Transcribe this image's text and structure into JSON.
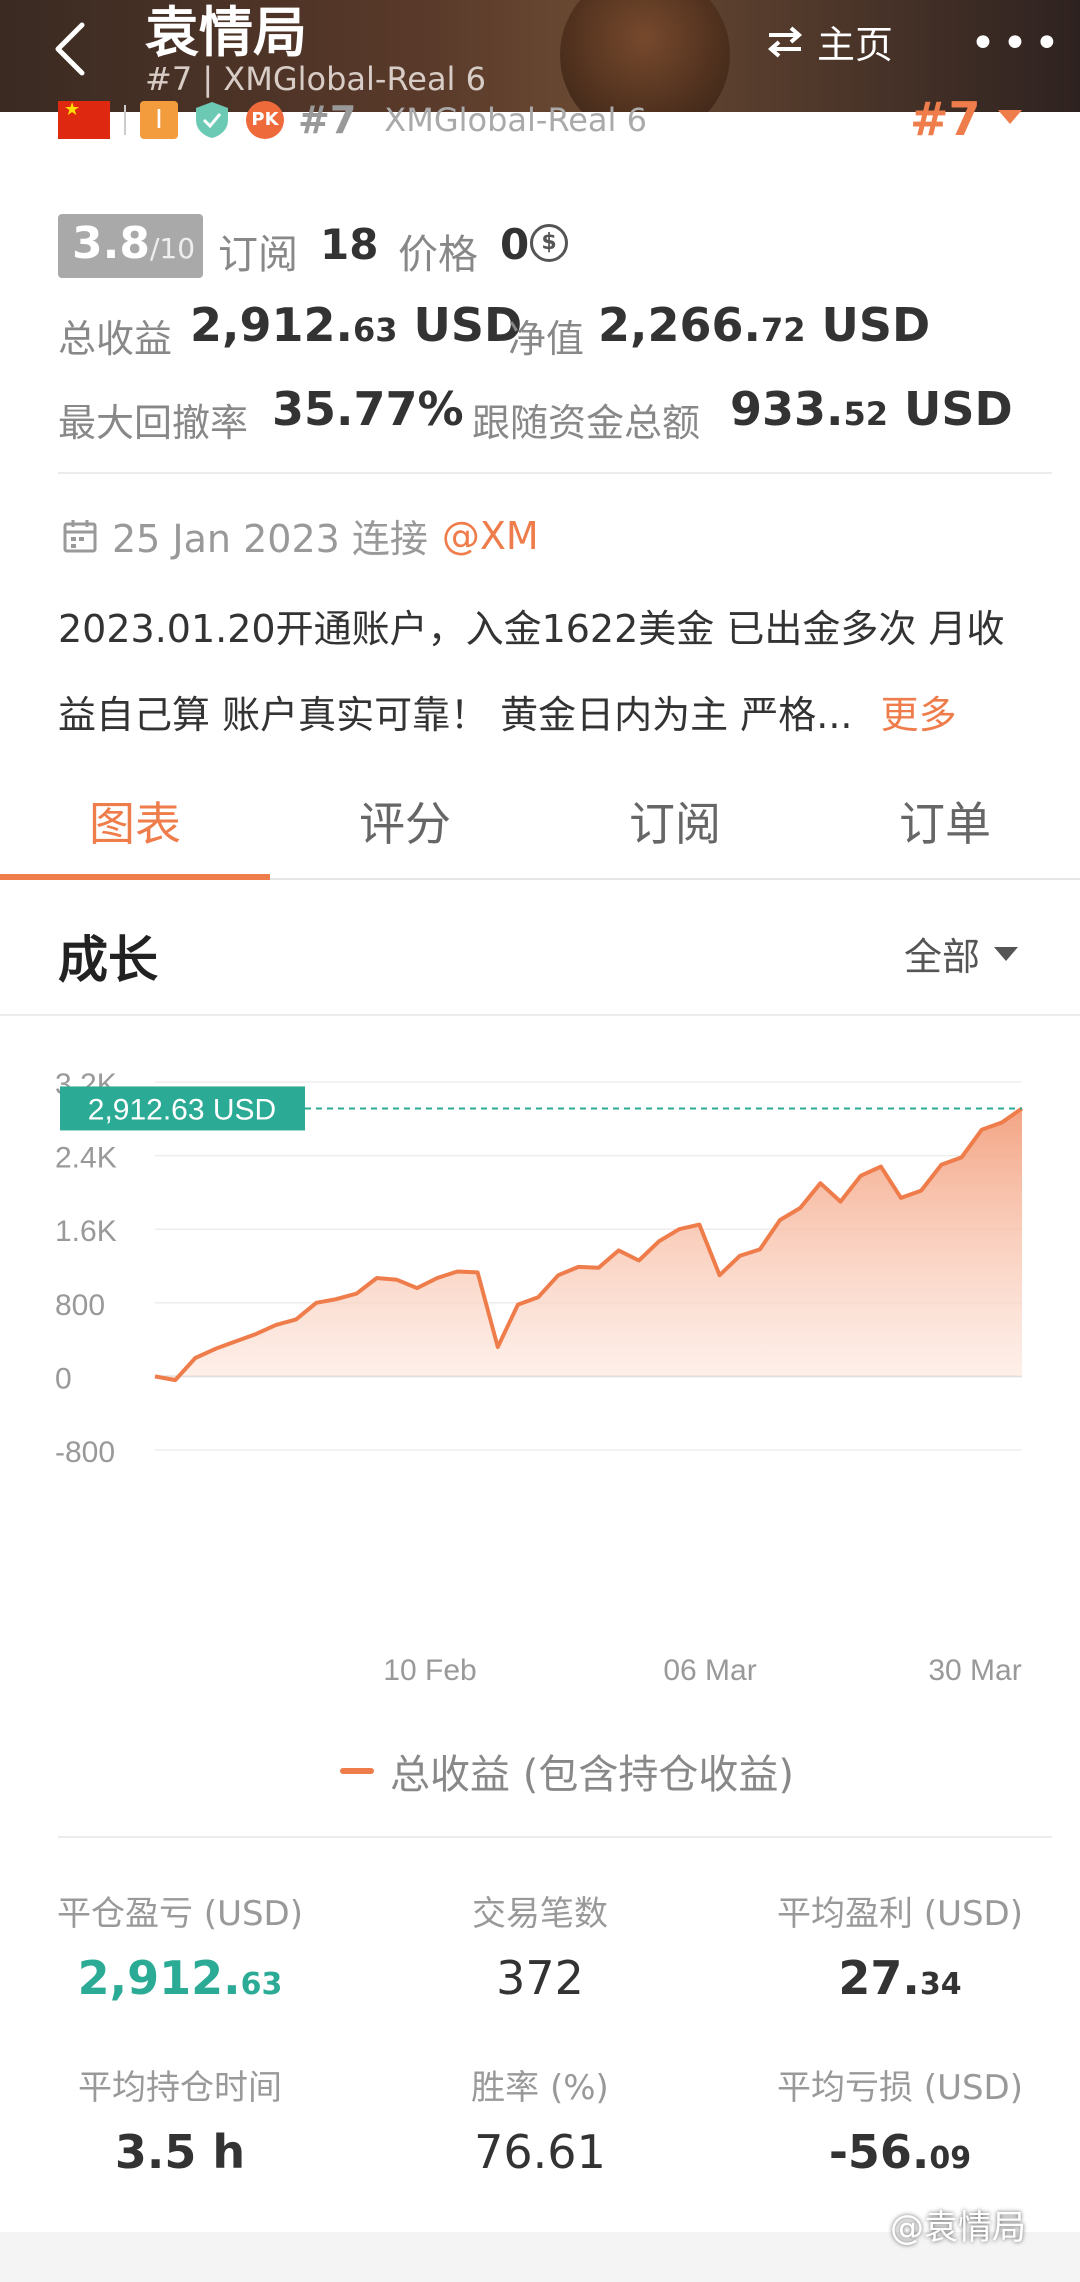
{
  "header": {
    "title": "袁情局",
    "subtitle": "#7 | XMGlobal-Real 6",
    "home_label": "主页",
    "more_label": "•••"
  },
  "badges": {
    "rank": "#7",
    "account": "XMGlobal-Real 6",
    "rank_right": "#7",
    "badge_o": "I",
    "badge_pk": "PK"
  },
  "stats_top": {
    "score": "3.8",
    "score_max": "/10",
    "subscribe_label": "订阅",
    "subscribe_value": "18",
    "price_label": "价格",
    "price_value": "0",
    "coin_symbol": "$",
    "total_profit_label": "总收益",
    "total_profit_int": "2,912.",
    "total_profit_dec": "63",
    "total_profit_unit": "USD",
    "equity_label": "净值",
    "equity_int": "2,266.",
    "equity_dec": "72",
    "equity_unit": "USD",
    "drawdown_label": "最大回撤率",
    "drawdown_value": "35.77%",
    "follow_label": "跟随资金总额",
    "follow_int": "933.",
    "follow_dec": "52",
    "follow_unit": "USD"
  },
  "connect": {
    "date": "25 Jan 2023 连接",
    "broker": "@XM"
  },
  "description": {
    "text": "2023.01.20开通账户，入金1622美金 已出金多次 月收益自己算 账户真实可靠！  黄金日内为主 严格...",
    "more": "更多"
  },
  "tabs": [
    {
      "label": "图表"
    },
    {
      "label": "评分"
    },
    {
      "label": "订阅"
    },
    {
      "label": "订单"
    }
  ],
  "section": {
    "title": "成长",
    "filter": "全部"
  },
  "chart_data": {
    "type": "area",
    "title": "",
    "series": [
      {
        "name": "总收益 (包含持仓收益)",
        "color": "#ef7d4b",
        "values": [
          0,
          -40,
          200,
          300,
          380,
          460,
          560,
          620,
          800,
          840,
          900,
          1070,
          1050,
          960,
          1070,
          1140,
          1130,
          320,
          780,
          860,
          1100,
          1190,
          1180,
          1370,
          1260,
          1470,
          1600,
          1650,
          1100,
          1310,
          1380,
          1700,
          1830,
          2100,
          1900,
          2180,
          2280,
          1940,
          2020,
          2300,
          2380,
          2680,
          2760,
          2912.63
        ]
      }
    ],
    "x_tick_labels": [
      "10 Feb",
      "06 Mar",
      "30 Mar"
    ],
    "y_tick_labels": [
      "3.2K",
      "2.4K",
      "1.6K",
      "800",
      "0",
      "-800"
    ],
    "ylim": [
      -800,
      3200
    ],
    "current_value_label": "2,912.63 USD",
    "current_value": 2912.63,
    "grid": true,
    "legend_position": "bottom"
  },
  "stats_grid": {
    "closed_pnl_label": "平仓盈亏 (USD)",
    "closed_pnl_int": "2,912.",
    "closed_pnl_dec": "63",
    "trades_label": "交易笔数",
    "trades_value": "372",
    "avg_profit_label": "平均盈利 (USD)",
    "avg_profit_int": "27.",
    "avg_profit_dec": "34",
    "avg_hold_label": "平均持仓时间",
    "avg_hold_value": "3.5 h",
    "win_rate_label": "胜率 (%)",
    "win_rate_value": "76.61",
    "avg_loss_label": "平均亏损 (USD)",
    "avg_loss_int": "-56.",
    "avg_loss_dec": "09"
  },
  "watermark": "@袁情局",
  "colors": {
    "accent": "#ef7d4b",
    "green": "#2bab95"
  }
}
